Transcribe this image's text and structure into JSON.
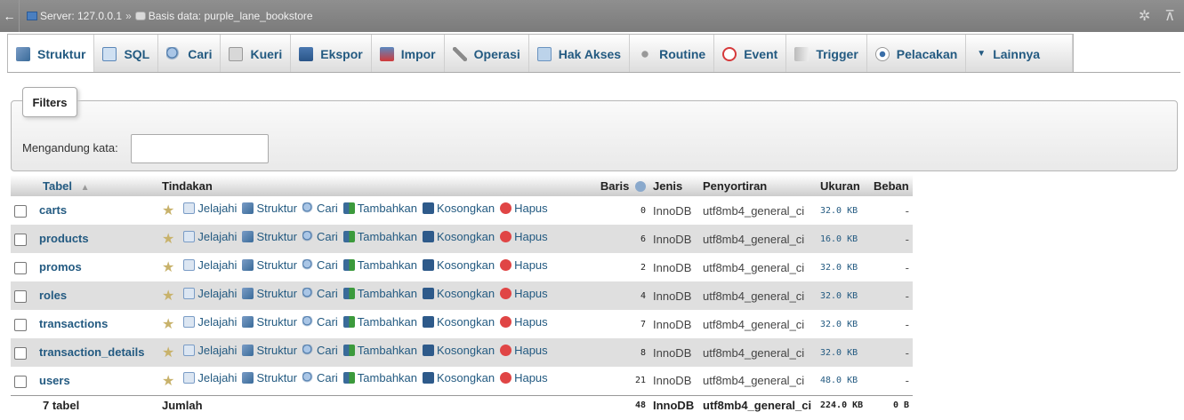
{
  "topbar": {
    "back_glyph": "←",
    "server_label": "Server: 127.0.0.1",
    "separator": "»",
    "database_label": "Basis data: purple_lane_bookstore",
    "settings_glyph": "✲",
    "collapse_glyph": "⊼"
  },
  "tabs": [
    {
      "label": "Struktur",
      "icon": "structure-icon"
    },
    {
      "label": "SQL",
      "icon": "sql-icon"
    },
    {
      "label": "Cari",
      "icon": "search-icon"
    },
    {
      "label": "Kueri",
      "icon": "query-icon"
    },
    {
      "label": "Ekspor",
      "icon": "export-icon"
    },
    {
      "label": "Impor",
      "icon": "import-icon"
    },
    {
      "label": "Operasi",
      "icon": "wrench-icon"
    },
    {
      "label": "Hak Akses",
      "icon": "privileges-icon"
    },
    {
      "label": "Routine",
      "icon": "routines-icon"
    },
    {
      "label": "Event",
      "icon": "clock-icon"
    },
    {
      "label": "Trigger",
      "icon": "trigger-icon"
    },
    {
      "label": "Pelacakan",
      "icon": "eye-icon"
    },
    {
      "label": "Lainnya",
      "icon": "triangle-down-icon"
    }
  ],
  "filters": {
    "legend": "Filters",
    "contains_label": "Mengandung kata:",
    "contains_value": ""
  },
  "table": {
    "headers": {
      "tabel": "Tabel",
      "tindakan": "Tindakan",
      "baris": "Baris",
      "jenis": "Jenis",
      "penyortiran": "Penyortiran",
      "ukuran": "Ukuran",
      "beban": "Beban"
    },
    "actions": {
      "jelajahi": "Jelajahi",
      "struktur": "Struktur",
      "cari": "Cari",
      "tambahkan": "Tambahkan",
      "kosongkan": "Kosongkan",
      "hapus": "Hapus"
    },
    "rows": [
      {
        "name": "carts",
        "rows": "0",
        "engine": "InnoDB",
        "collation": "utf8mb4_general_ci",
        "size": "32.0 KB",
        "overhead": "-"
      },
      {
        "name": "products",
        "rows": "6",
        "engine": "InnoDB",
        "collation": "utf8mb4_general_ci",
        "size": "16.0 KB",
        "overhead": "-"
      },
      {
        "name": "promos",
        "rows": "2",
        "engine": "InnoDB",
        "collation": "utf8mb4_general_ci",
        "size": "32.0 KB",
        "overhead": "-"
      },
      {
        "name": "roles",
        "rows": "4",
        "engine": "InnoDB",
        "collation": "utf8mb4_general_ci",
        "size": "32.0 KB",
        "overhead": "-"
      },
      {
        "name": "transactions",
        "rows": "7",
        "engine": "InnoDB",
        "collation": "utf8mb4_general_ci",
        "size": "32.0 KB",
        "overhead": "-"
      },
      {
        "name": "transaction_details",
        "rows": "8",
        "engine": "InnoDB",
        "collation": "utf8mb4_general_ci",
        "size": "32.0 KB",
        "overhead": "-"
      },
      {
        "name": "users",
        "rows": "21",
        "engine": "InnoDB",
        "collation": "utf8mb4_general_ci",
        "size": "48.0 KB",
        "overhead": "-"
      }
    ],
    "footer": {
      "count": "7 tabel",
      "sum_label": "Jumlah",
      "rows": "48",
      "engine": "InnoDB",
      "collation": "utf8mb4_general_ci",
      "size": "224.0 KB",
      "overhead": "0 B"
    }
  },
  "colors": {
    "link": "#235a81",
    "row_alt": "#dfdfdf",
    "topbar": "#858585"
  }
}
